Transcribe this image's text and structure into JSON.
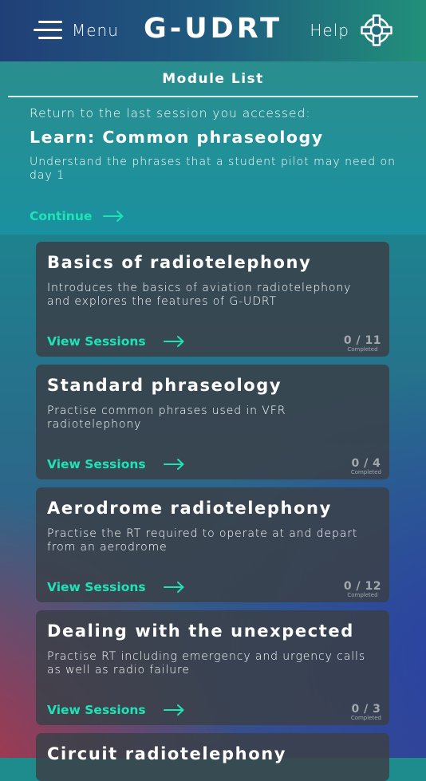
{
  "header": {
    "menu_label": "Menu",
    "app_title": "G-UDRT",
    "help_label": "Help"
  },
  "banner": {
    "section_title": "Module List",
    "return_text": "Return to the last session you accessed:",
    "last_session_title": "Learn: Common phraseology",
    "last_session_desc": "Understand the phrases that a student pilot may need on day 1",
    "continue_label": "Continue"
  },
  "modules": [
    {
      "title": "Basics of radiotelephony",
      "description": "Introduces the basics of aviation radiotelephony and explores the features of G-UDRT",
      "action": "View Sessions",
      "progress": "0 / 11",
      "progress_label": "Completed"
    },
    {
      "title": "Standard phraseology",
      "description": "Practise common phrases used in VFR radiotelephony",
      "action": "View Sessions",
      "progress": "0 / 4",
      "progress_label": "Completed"
    },
    {
      "title": "Aerodrome radiotelephony",
      "description": "Practise the RT required to operate at and depart from an aerodrome",
      "action": "View Sessions",
      "progress": "0 / 12",
      "progress_label": "Completed"
    },
    {
      "title": "Dealing with the unexpected",
      "description": "Practise RT including emergency and urgency calls as well as radio failure",
      "action": "View Sessions",
      "progress": "0 / 3",
      "progress_label": "Completed"
    },
    {
      "title": "Circuit radiotelephony"
    }
  ],
  "icons": {
    "menu": "hamburger-menu-icon",
    "help": "lifebuoy-icon",
    "arrow": "arrow-right-icon"
  },
  "colors": {
    "accent": "#1ee3b6",
    "card": "#3a4048",
    "header_left": "#203f78",
    "header_right": "#21907a"
  }
}
